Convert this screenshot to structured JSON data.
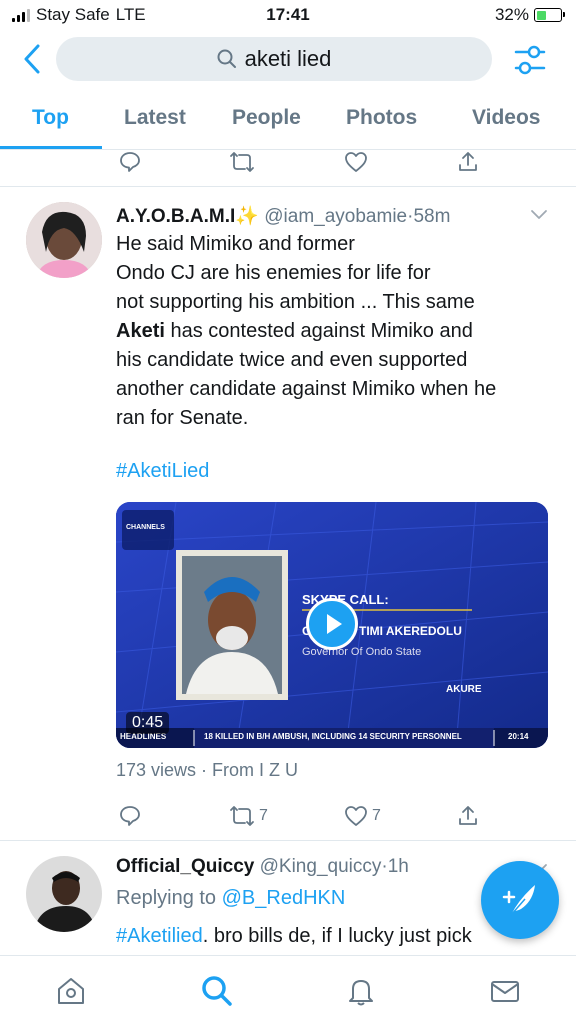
{
  "status_bar": {
    "carrier": "Stay Safe",
    "network": "LTE",
    "time": "17:41",
    "battery": "32%",
    "battery_level": 0.32
  },
  "search": {
    "query": "aketi lied",
    "icons": [
      "back-chevron-icon",
      "search-icon",
      "filter-sliders-icon"
    ]
  },
  "tabs": [
    {
      "label": "Top",
      "active": true
    },
    {
      "label": "Latest",
      "active": false
    },
    {
      "label": "People",
      "active": false
    },
    {
      "label": "Photos",
      "active": false
    },
    {
      "label": "Videos",
      "active": false
    }
  ],
  "colors": {
    "accent": "#1da1f2",
    "muted": "#657786",
    "search_bg": "#e6ecf0",
    "divider": "#e1e8ed"
  },
  "tweet1": {
    "name": "A.Y.O.B.A.M.I",
    "name_emoji": "✨",
    "handle": "@iam_ayobamie",
    "separator": "·",
    "time": "58m",
    "text_line1": "He said Mimiko and former",
    "text_line2": "Ondo CJ are his enemies for life for",
    "text_line3": "not supporting his ambition ... This same",
    "text_bold": "Aketi",
    "text_line4_rest": " has contested against Mimiko and",
    "text_line5": "his candidate twice and even supported",
    "text_line6": "another candidate against Mimiko when he",
    "text_line7": "ran for Senate.",
    "hashtag": "#AketiLied",
    "video": {
      "duration": "0:45",
      "channel_badge": "CHANNELS",
      "skype_label": "SKYPE CALL:",
      "guest_name": "TIMI AKEREDOLU",
      "guest_prefix": "O",
      "guest_title": "Governor Of Ondo State",
      "location": "AKURE",
      "ticker_label": "HEADLINES",
      "ticker_text": "18 KILLED IN B/H AMBUSH, INCLUDING 14 SECURITY PERSONNEL",
      "ticker_time": "20:14"
    },
    "views": "173 views",
    "from": "From I Z U",
    "retweets": "7",
    "likes": "7"
  },
  "tweet2": {
    "name": "Official_Quiccy",
    "handle": "@King_quiccy",
    "separator": "·",
    "time": "1h",
    "replying_label": "Replying to",
    "replying_handle": "@B_RedHKN",
    "hashtag": "#Aketilied",
    "text": ". bro bills de, if I lucky just pick"
  },
  "bottom_nav": [
    "home-icon",
    "search-icon",
    "notifications-bell-icon",
    "messages-envelope-icon"
  ]
}
